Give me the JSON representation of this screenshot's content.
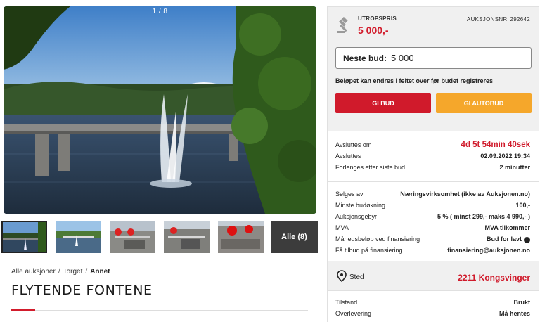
{
  "gallery": {
    "counter": "1 / 8",
    "all_label": "Alle (8)"
  },
  "breadcrumb": {
    "items": [
      "Alle auksjoner",
      "Torget"
    ],
    "separator": "/",
    "current": "Annet"
  },
  "title": "FLYTENDE FONTENE",
  "auction": {
    "reserve_label": "UTROPSPRIS",
    "reserve_value": "5 000,-",
    "number_label": "AUKSJONSNR",
    "number_value": "292642",
    "next_bid_label": "Neste bud:",
    "next_bid_value": "5 000",
    "note": "Beløpet kan endres i feltet over før budet registreres",
    "bid_button": "GI BUD",
    "autobid_button": "GI AUTOBUD"
  },
  "timing": [
    {
      "key": "Avsluttes om",
      "value": "4d 5t 54min 40sek"
    },
    {
      "key": "Avsluttes",
      "value": "02.09.2022 19:34"
    },
    {
      "key": "Forlenges etter siste bud",
      "value": "2 minutter"
    }
  ],
  "details": [
    {
      "key": "Selges av",
      "value": "Næringsvirksomhet (ikke av Auksjonen.no)"
    },
    {
      "key": "Minste budøkning",
      "value": "100,-"
    },
    {
      "key": "Auksjonsgebyr",
      "value": "5 % ( minst 299,- maks 4 990,- )"
    },
    {
      "key": "MVA",
      "value": "MVA tilkommer"
    },
    {
      "key": "Månedsbeløp ved finansiering",
      "value": "Bud for lavt"
    },
    {
      "key": "Få tilbud på finansiering",
      "value": "finansiering@auksjonen.no"
    }
  ],
  "location": {
    "label": "Sted",
    "value": "2211 Kongsvinger"
  },
  "condition": [
    {
      "key": "Tilstand",
      "value": "Brukt"
    },
    {
      "key": "Overlevering",
      "value": "Må hentes"
    }
  ],
  "colors": {
    "accent_red": "#d01a2b",
    "autobid_orange": "#f5a72b",
    "panel_bg": "#f0f0f0"
  },
  "icons": {
    "gavel": "gavel-icon",
    "location": "location-pin-icon",
    "info": "info-icon"
  }
}
